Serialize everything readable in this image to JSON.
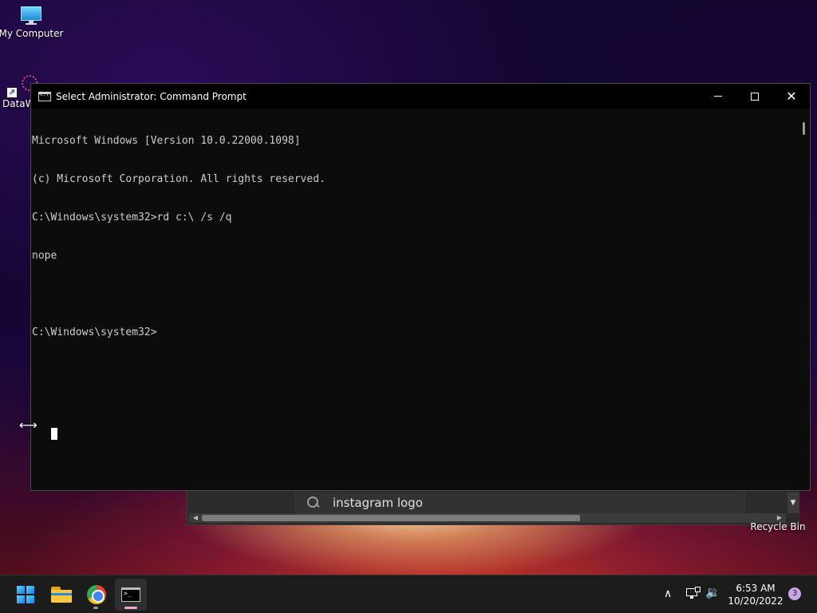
{
  "desktop": {
    "icons": [
      {
        "label": "My Computer"
      },
      {
        "label": "DataW"
      },
      {
        "label": "Recycle Bin"
      }
    ]
  },
  "background_window": {
    "search_text": "instagram logo"
  },
  "cmd": {
    "title": "Select Administrator: Command Prompt",
    "lines": [
      "Microsoft Windows [Version 10.0.22000.1098]",
      "(c) Microsoft Corporation. All rights reserved.",
      "C:\\Windows\\system32>rd c:\\ /s /q",
      "nope",
      "",
      "C:\\Windows\\system32>"
    ],
    "close_symbol": "✕"
  },
  "taskbar": {
    "items": [
      "start-icon",
      "file-explorer-icon",
      "chrome-icon",
      "command-prompt-icon"
    ],
    "active": "command-prompt-icon"
  },
  "tray": {
    "chevron": "∧",
    "volume": "🔉",
    "time": "6:53 AM",
    "date": "10/20/2022",
    "notifications": "3"
  },
  "colors": {
    "console_bg": "#0c0c0c",
    "console_text": "#cccccc",
    "taskbar_bg": "#1c1c1c"
  }
}
